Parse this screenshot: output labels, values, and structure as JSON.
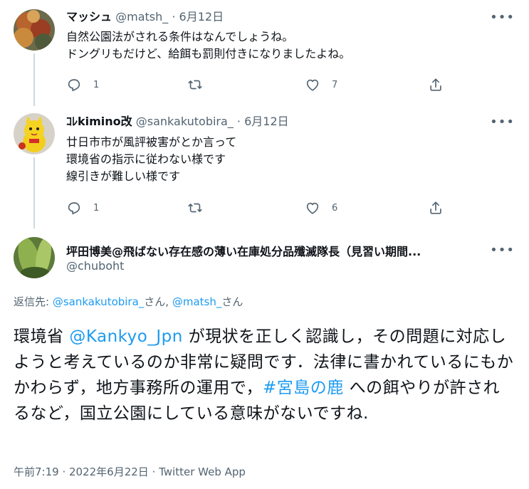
{
  "reply1": {
    "name": "マッシュ",
    "handle": "@matsh_",
    "dot": "·",
    "date": "6月12日",
    "text": "自然公園法がされる条件はなんでしょうね。\nドングリもだけど、給餌も罰則付きになりましたよね。",
    "replies": "1",
    "retweets": "",
    "likes": "7"
  },
  "reply2": {
    "name": "ｺﾚkimino改",
    "handle": "@sankakutobira_",
    "dot": "·",
    "date": "6月12日",
    "text": "廿日市市が風評被害がとか言って\n環境省の指示に従わない様です\n線引きが難しい様です",
    "replies": "1",
    "retweets": "",
    "likes": "6"
  },
  "main": {
    "name": "坪田博美@飛ばない存在感の薄い在庫処分品殲滅隊長（見習い期間...",
    "handle": "@chuboht",
    "reply_prefix": "返信先: ",
    "reply_user1": "@sankakutobira_",
    "reply_san1": "さん, ",
    "reply_user2": "@matsh_",
    "reply_san2": "さん",
    "text_1": "環境省 ",
    "mention": "@Kankyo_Jpn",
    "text_2": " が現状を正しく認識し，その問題に対応しようと考えているのか非常に疑問です．法律に書かれているにもかかわらず，地方事務所の運用で，",
    "hashtag": "#宮島の鹿",
    "text_3": " への餌やりが許されるなど，国立公園にしている意味がないですね.",
    "timestamp": "午前7:19 · 2022年6月22日 · Twitter Web App"
  },
  "colors": {
    "link": "#1d9bf0",
    "muted": "#536471",
    "text": "#0f1419"
  },
  "icons": [
    "reply-icon",
    "retweet-icon",
    "like-icon",
    "share-icon",
    "more-icon"
  ]
}
